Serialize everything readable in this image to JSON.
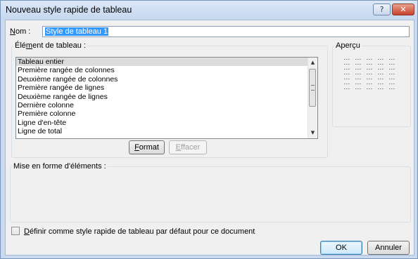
{
  "window": {
    "title": "Nouveau style rapide de tableau",
    "help_label": "?",
    "close_label": "✕"
  },
  "name_field": {
    "label_mnemonic": "N",
    "label_rest": "om :",
    "value": "Style de tableau 1"
  },
  "element_group": {
    "legend_pre": "Élé",
    "legend_mnemonic": "m",
    "legend_post": "ent de tableau :",
    "items": [
      "Tableau entier",
      "Première rangée de colonnes",
      "Deuxième rangée de colonnes",
      "Première rangée de lignes",
      "Deuxième rangée de lignes",
      "Dernière colonne",
      "Première colonne",
      "Ligne d'en-tête",
      "Ligne de total"
    ],
    "selected_index": 0,
    "format_button": {
      "mnemonic": "F",
      "rest": "ormat"
    },
    "clear_button": {
      "mnemonic": "E",
      "rest": "ffacer"
    }
  },
  "preview": {
    "legend": "Aperçu"
  },
  "formatting_group": {
    "legend": "Mise en forme d'éléments :"
  },
  "default_checkbox": {
    "mnemonic": "D",
    "rest": "éfinir comme style rapide de tableau par défaut pour ce document",
    "checked": false
  },
  "buttons": {
    "ok": "OK",
    "cancel": "Annuler"
  },
  "colors": {
    "title_bar": "#c6d8ef",
    "selection": "#3399ff",
    "close_button": "#c7412b",
    "dialog_bg": "#f0f0f0"
  }
}
